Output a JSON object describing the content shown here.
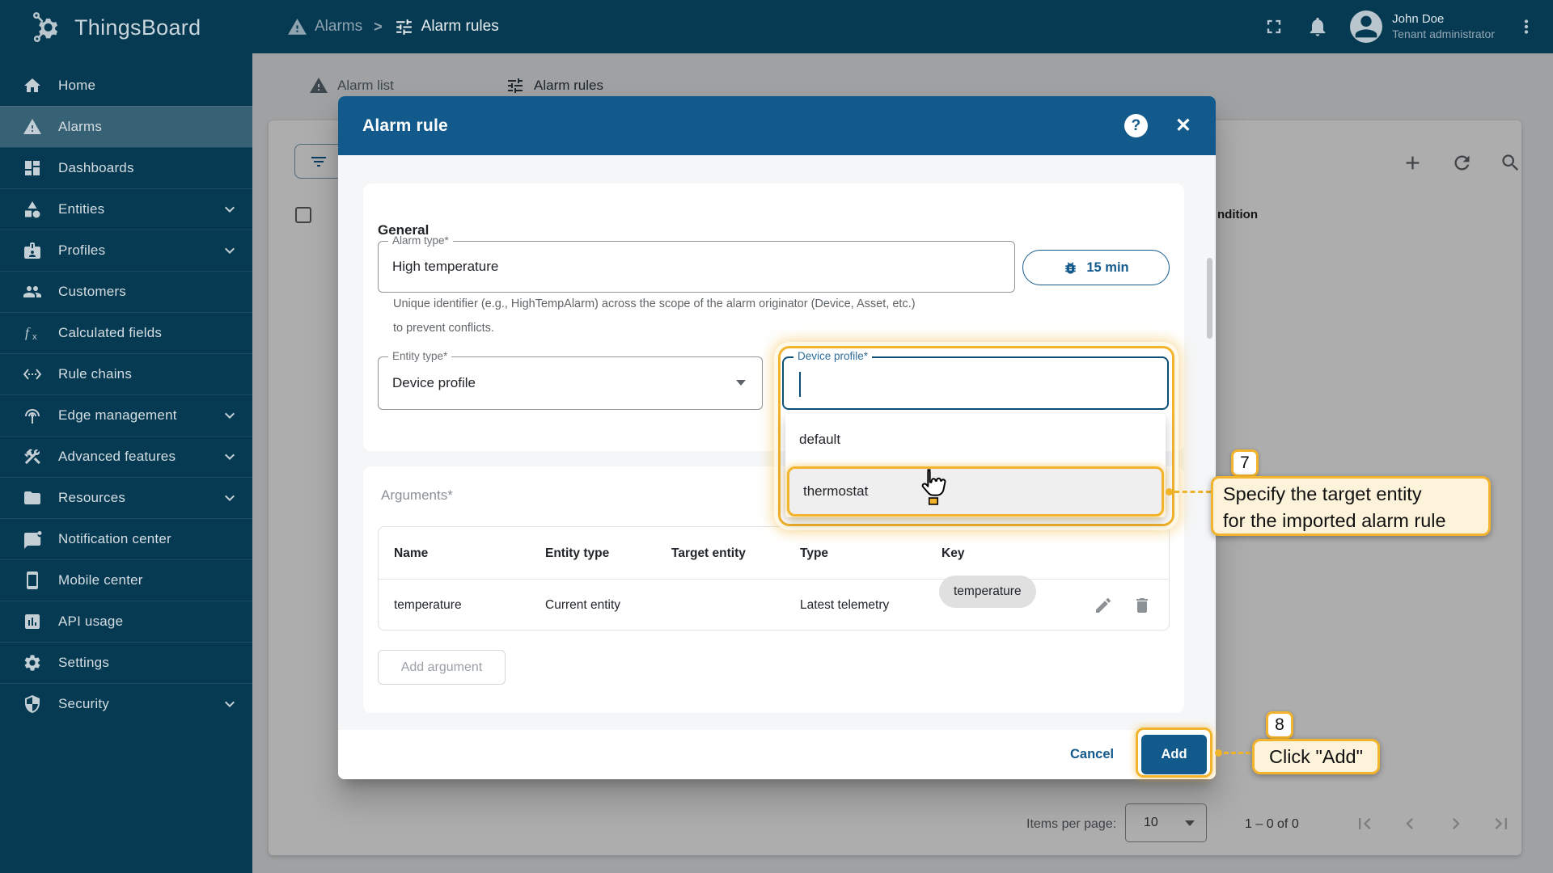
{
  "app": {
    "name": "ThingsBoard"
  },
  "colors": {
    "primary": "#135a8c",
    "appbar_bg": "#053a52",
    "annotation_border": "#f2b32d",
    "annotation_fill": "#fdf2da",
    "dim_overlay": "rgba(0,0,0,0.32)"
  },
  "header": {
    "breadcrumb": [
      {
        "icon": "warning",
        "label": "Alarms"
      },
      {
        "icon": "tune",
        "label": "Alarm rules"
      }
    ],
    "breadcrumb_separator": ">",
    "user": {
      "name": "John Doe",
      "role": "Tenant administrator"
    }
  },
  "sidebar": {
    "items": [
      {
        "id": "home",
        "icon": "home",
        "label": "Home",
        "selected": false,
        "expandable": false
      },
      {
        "id": "alarms",
        "icon": "warning",
        "label": "Alarms",
        "selected": true,
        "expandable": false
      },
      {
        "id": "dashboards",
        "icon": "dashboard",
        "label": "Dashboards",
        "selected": false,
        "expandable": false
      },
      {
        "id": "entities",
        "icon": "shapes",
        "label": "Entities",
        "selected": false,
        "expandable": true
      },
      {
        "id": "profiles",
        "icon": "badge",
        "label": "Profiles",
        "selected": false,
        "expandable": true
      },
      {
        "id": "customers",
        "icon": "people",
        "label": "Customers",
        "selected": false,
        "expandable": false
      },
      {
        "id": "calculated-fields",
        "icon": "fx",
        "label": "Calculated fields",
        "selected": false,
        "expandable": false
      },
      {
        "id": "rule-chains",
        "icon": "ethernet",
        "label": "Rule chains",
        "selected": false,
        "expandable": false
      },
      {
        "id": "edge-management",
        "icon": "antenna",
        "label": "Edge management",
        "selected": false,
        "expandable": true
      },
      {
        "id": "advanced-features",
        "icon": "construction",
        "label": "Advanced features",
        "selected": false,
        "expandable": true
      },
      {
        "id": "resources",
        "icon": "folder",
        "label": "Resources",
        "selected": false,
        "expandable": true
      },
      {
        "id": "notification-center",
        "icon": "notification-chat",
        "label": "Notification center",
        "selected": false,
        "expandable": false
      },
      {
        "id": "mobile-center",
        "icon": "smartphone",
        "label": "Mobile center",
        "selected": false,
        "expandable": false
      },
      {
        "id": "api-usage",
        "icon": "chart",
        "label": "API usage",
        "selected": false,
        "expandable": false
      },
      {
        "id": "settings",
        "icon": "gear",
        "label": "Settings",
        "selected": false,
        "expandable": false
      },
      {
        "id": "security",
        "icon": "shield",
        "label": "Security",
        "selected": false,
        "expandable": true
      }
    ]
  },
  "content": {
    "tabs": [
      {
        "icon": "warning",
        "label": "Alarm list",
        "active": false
      },
      {
        "icon": "tune",
        "label": "Alarm rules",
        "active": true
      }
    ],
    "column_header_partial": "ndition",
    "pagination": {
      "label": "Items per page:",
      "page_size": "10",
      "range": "1 – 0 of 0",
      "nav_icons": [
        "first-page",
        "chevron-left",
        "chevron-right",
        "last-page"
      ]
    }
  },
  "dialog": {
    "title": "Alarm rule",
    "general": {
      "heading": "General",
      "alarm_type": {
        "label": "Alarm type*",
        "value": "High temperature"
      },
      "schedule_chip": "15 min",
      "helper_line1": "Unique identifier (e.g., HighTempAlarm) across the scope of the alarm originator (Device, Asset, etc.)",
      "helper_line2": "to prevent conflicts.",
      "entity_type": {
        "label": "Entity type*",
        "value": "Device profile"
      },
      "device_profile": {
        "label": "Device profile*",
        "value": "",
        "options": [
          {
            "label": "default",
            "highlighted": false
          },
          {
            "label": "thermostat",
            "highlighted": true
          }
        ]
      }
    },
    "arguments": {
      "heading": "Arguments*",
      "columns": [
        "Name",
        "Entity type",
        "Target entity",
        "Type",
        "Key"
      ],
      "rows": [
        {
          "name": "temperature",
          "entity_type": "Current entity",
          "target_entity": "",
          "type": "Latest telemetry",
          "key": "temperature"
        }
      ],
      "add_button": "Add argument"
    },
    "footer": {
      "cancel": "Cancel",
      "add": "Add"
    }
  },
  "annotations": {
    "step7": {
      "number": "7",
      "line1": "Specify the target entity",
      "line2": "for the imported alarm rule"
    },
    "step8": {
      "number": "8",
      "text": "Click \"Add\""
    }
  }
}
